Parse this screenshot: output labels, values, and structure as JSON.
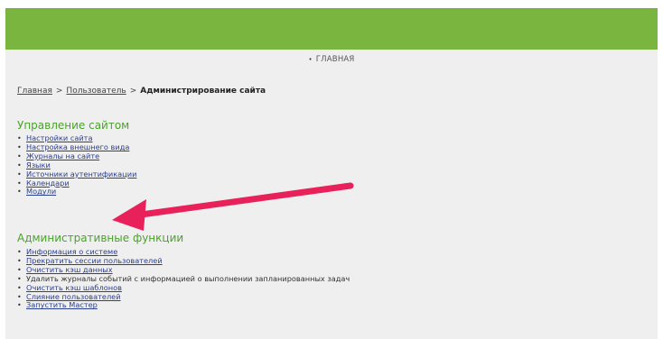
{
  "nav": {
    "home_label": "главная"
  },
  "breadcrumb": {
    "home": "Главная",
    "users": "Пользователь",
    "separator": ">",
    "current": "Администрирование сайта"
  },
  "site_management": {
    "title": "Управление сайтом",
    "items": [
      {
        "label": "Настройки сайта"
      },
      {
        "label": "Настройка внешнего вида"
      },
      {
        "label": "Журналы на сайте"
      },
      {
        "label": "Языки"
      },
      {
        "label": "Источники аутентификации"
      },
      {
        "label": "Календари"
      },
      {
        "label": "Модули"
      }
    ]
  },
  "admin_functions": {
    "title": "Административные функции",
    "items": [
      {
        "label": "Информация о системе"
      },
      {
        "label": "Прекратить сессии пользователей"
      },
      {
        "label": "Очистить кэш данных"
      },
      {
        "label": "Удалить журналы событий с информацией о выполнении запланированных задач"
      },
      {
        "label": "Очистить кэш шаблонов"
      },
      {
        "label": "Слияние пользователей"
      },
      {
        "label": "Запустить Мастер"
      }
    ]
  },
  "colors": {
    "header": "#7ab63f",
    "section_title": "#4aa32b",
    "arrow": "#e8215a"
  }
}
